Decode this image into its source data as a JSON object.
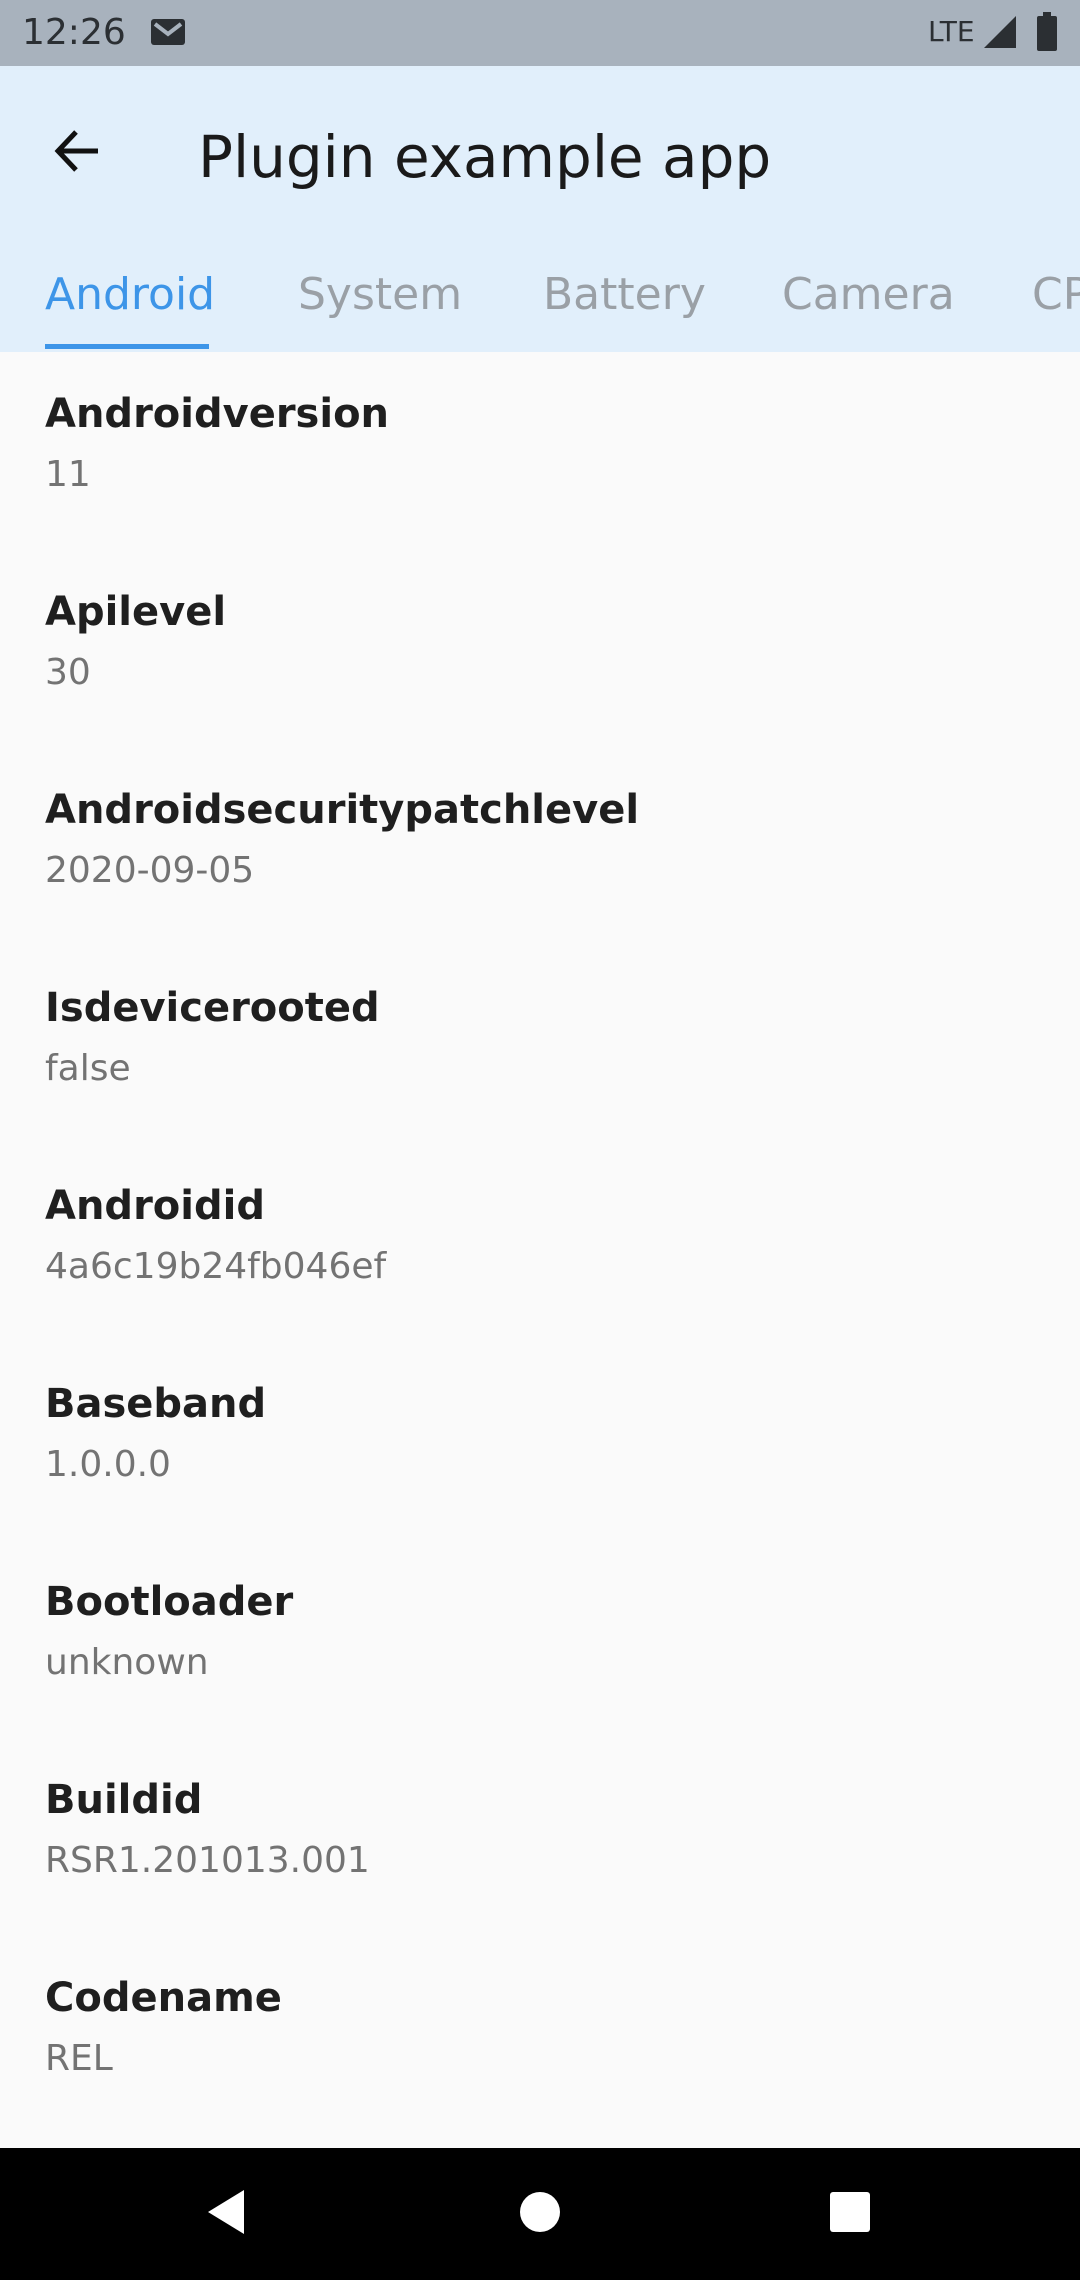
{
  "status_bar": {
    "time": "12:26",
    "network": "LTE",
    "icons": [
      "gmail-icon",
      "signal-icon",
      "battery-icon"
    ]
  },
  "app_bar": {
    "title": "Plugin example app",
    "back_icon": "arrow-back-icon"
  },
  "tabs": [
    {
      "label": "Android",
      "active": true
    },
    {
      "label": "System",
      "active": false
    },
    {
      "label": "Battery",
      "active": false
    },
    {
      "label": "Camera",
      "active": false
    },
    {
      "label": "CPU",
      "active": false
    }
  ],
  "items": [
    {
      "title": "Androidversion",
      "value": "11"
    },
    {
      "title": "Apilevel",
      "value": "30"
    },
    {
      "title": "Androidsecuritypatchlevel",
      "value": "2020-09-05"
    },
    {
      "title": "Isdevicerooted",
      "value": "false"
    },
    {
      "title": "Androidid",
      "value": "4a6c19b24fb046ef"
    },
    {
      "title": "Baseband",
      "value": "1.0.0.0"
    },
    {
      "title": "Bootloader",
      "value": "unknown"
    },
    {
      "title": "Buildid",
      "value": "RSR1.201013.001"
    },
    {
      "title": "Codename",
      "value": "REL"
    }
  ],
  "nav_bar": {
    "icons": [
      "back-triangle-icon",
      "home-circle-icon",
      "recents-square-icon"
    ]
  },
  "colors": {
    "status_bar": "#a8b2bd",
    "app_bar": "#e1effb",
    "accent": "#3d95e8",
    "background": "#fafafa",
    "nav_bar": "#000000"
  }
}
